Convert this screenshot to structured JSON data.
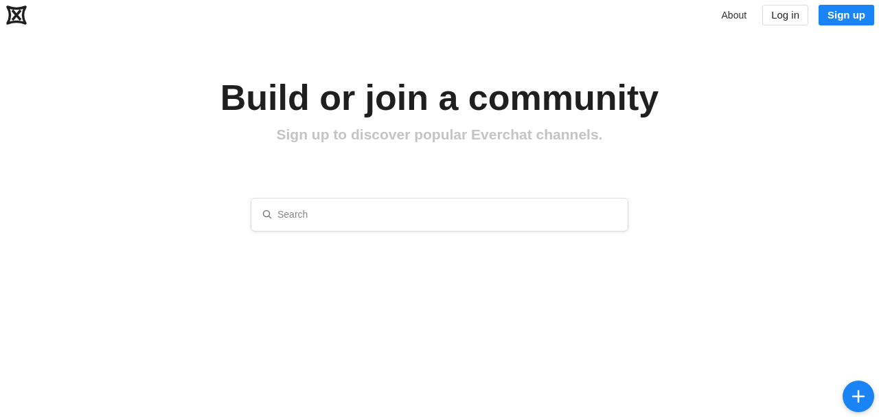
{
  "nav": {
    "links": [
      "About"
    ],
    "buttons": [
      {
        "label": "Log in",
        "kind": "outline"
      },
      {
        "label": "Sign up",
        "kind": "primary"
      }
    ]
  },
  "hero": {
    "title": "Build or join a community",
    "subtitle": "Sign up to discover popular Everchat channels."
  },
  "search": {
    "placeholder": "Search"
  }
}
